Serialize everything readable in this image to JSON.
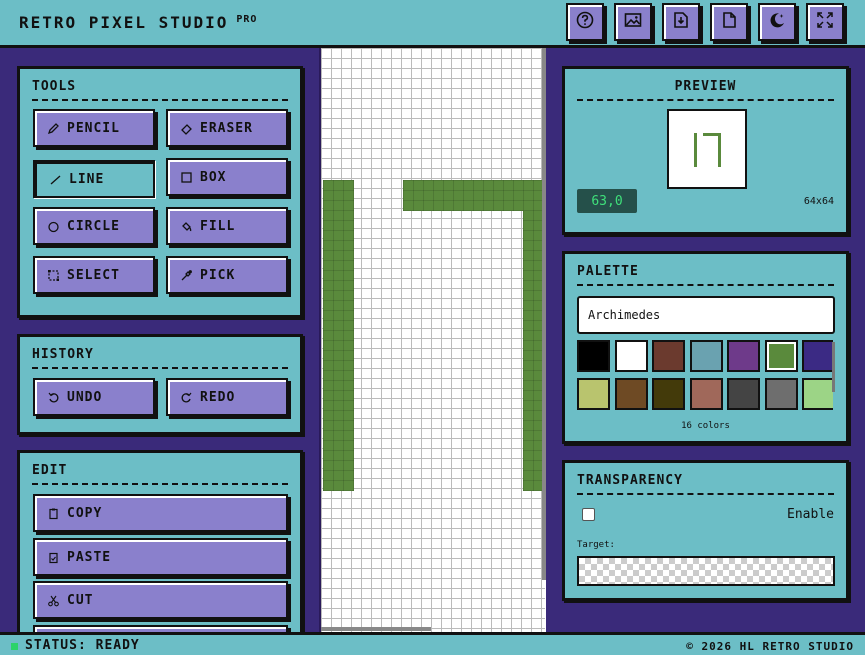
{
  "header": {
    "title": "RETRO PIXEL STUDIO",
    "badge": "PRO",
    "buttons": [
      {
        "name": "help-button",
        "icon": "question-icon"
      },
      {
        "name": "image-button",
        "icon": "image-icon"
      },
      {
        "name": "download-button",
        "icon": "download-icon"
      },
      {
        "name": "new-file-button",
        "icon": "file-icon"
      },
      {
        "name": "theme-button",
        "icon": "moon-icon"
      },
      {
        "name": "fullscreen-button",
        "icon": "fullscreen-icon"
      }
    ]
  },
  "tools": {
    "title": "TOOLS",
    "items": [
      {
        "label": "PENCIL",
        "icon": "pencil-icon",
        "active": false
      },
      {
        "label": "ERASER",
        "icon": "eraser-icon",
        "active": false
      },
      {
        "label": "LINE",
        "icon": "line-icon",
        "active": true
      },
      {
        "label": "BOX",
        "icon": "box-icon",
        "active": false
      },
      {
        "label": "CIRCLE",
        "icon": "circle-icon",
        "active": false
      },
      {
        "label": "FILL",
        "icon": "fill-icon",
        "active": false
      },
      {
        "label": "SELECT",
        "icon": "select-icon",
        "active": false
      },
      {
        "label": "PICK",
        "icon": "picker-icon",
        "active": false
      }
    ]
  },
  "history": {
    "title": "HISTORY",
    "undo_label": "UNDO",
    "redo_label": "REDO"
  },
  "edit": {
    "title": "EDIT",
    "copy_label": "COPY",
    "paste_label": "PASTE",
    "cut_label": "CUT"
  },
  "preview": {
    "title": "PREVIEW",
    "coordinates": "63,0",
    "dimensions": "64x64"
  },
  "palette": {
    "title": "PALETTE",
    "selected": "Archimedes",
    "count_label": "16 colors",
    "selected_color_index": 5,
    "colors": [
      "#000000",
      "#ffffff",
      "#6b3a2e",
      "#6aa2b0",
      "#6e3a8a",
      "#5a8a3c",
      "#3b2a84",
      "#ffffff",
      "#b9c46e",
      "#6e4a24",
      "#433a0a",
      "#a0685a",
      "#444444",
      "#6e6e6e",
      "#9cd486",
      "#ffffff"
    ]
  },
  "transparency": {
    "title": "TRANSPARENCY",
    "enable_label": "Enable",
    "enabled": false,
    "target_label": "Target:"
  },
  "canvas": {
    "drawing_color": "#5a8a3c"
  },
  "status": {
    "text": "STATUS: READY",
    "copyright": "© 2026 HL RETRO STUDIO"
  }
}
